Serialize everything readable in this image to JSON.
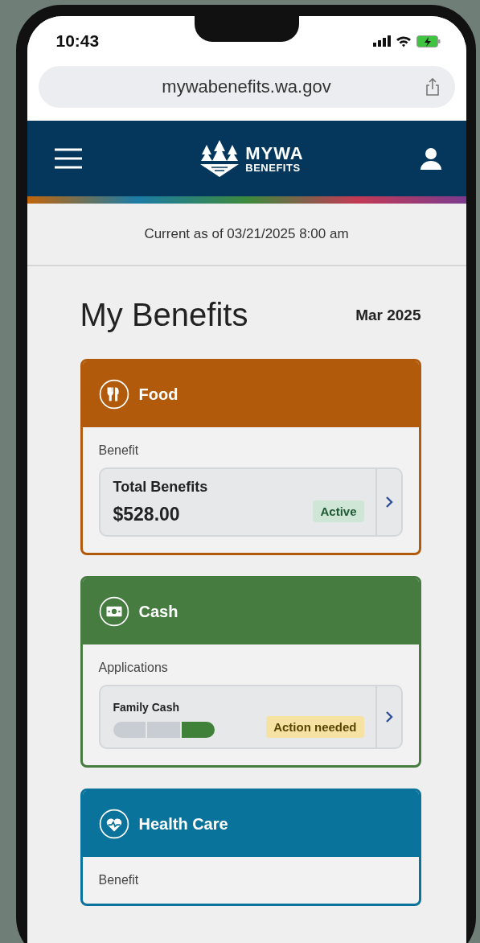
{
  "status_bar": {
    "time": "10:43"
  },
  "browser": {
    "url": "mywabenefits.wa.gov"
  },
  "header": {
    "logo_top": "MYWA",
    "logo_bottom": "BENEFITS"
  },
  "updated": "Current as of 03/21/2025 8:00 am",
  "page": {
    "title": "My Benefits",
    "month": "Mar 2025"
  },
  "programs": [
    {
      "kind": "food",
      "title": "Food",
      "color": "#b15a0b",
      "section": "Benefit",
      "item": {
        "kind": "amount",
        "label": "Total Benefits",
        "amount": "$528.00",
        "status": {
          "text": "Active",
          "kind": "success"
        }
      }
    },
    {
      "kind": "cash",
      "title": "Cash",
      "color": "#467c3f",
      "section": "Applications",
      "item": {
        "kind": "progress",
        "label": "Family Cash",
        "steps": [
          {
            "done": false
          },
          {
            "done": false
          },
          {
            "done": true
          }
        ],
        "status": {
          "text": "Action needed",
          "kind": "warning"
        }
      }
    },
    {
      "kind": "health",
      "title": "Health Care",
      "color": "#0a739c",
      "section": "Benefit"
    }
  ]
}
